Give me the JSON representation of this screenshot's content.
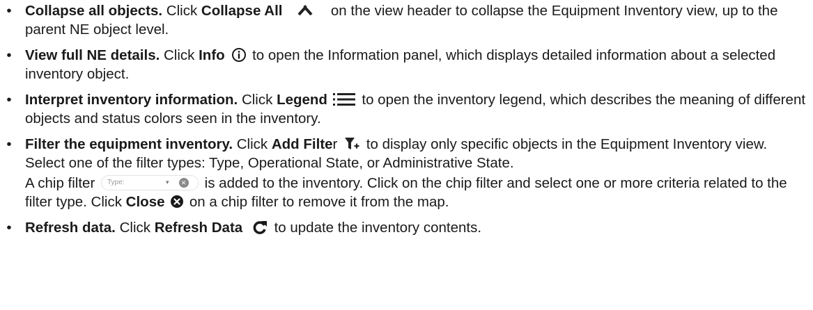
{
  "bullet_char": "•",
  "items": [
    {
      "title": "Collapse all objects.",
      "t1": " Click ",
      "label": "Collapse All",
      "t2": " on the view header to collapse the Equipment Inventory view, up to the parent NE object level.",
      "icon": "collapse-all-icon"
    },
    {
      "title": "View full NE details.",
      "t1": " Click ",
      "label": "Info",
      "t2": " to open the Information panel, which displays detailed information about a selected inventory object.",
      "icon": "info-icon"
    },
    {
      "title": "Interpret inventory information.",
      "t1": " Click ",
      "label": "Legend",
      "t2": " to open the inventory legend, which describes the meaning of different objects and status colors seen in the inventory.",
      "icon": "legend-list-icon"
    },
    {
      "title": "Filter the equipment inventory.",
      "t1": " Click ",
      "label": "Add Filte",
      "label_tail": "r",
      "t2": " to display only specific objects in the Equipment Inventory view. Select one of the filter types: Type, Operational State, or Administrative State.",
      "icon": "add-filter-icon",
      "para2": {
        "t1": "A chip filter ",
        "chip_label": "Type:",
        "t2": " is added to the inventory. Click on the chip filter and select one or more criteria related to the filter type. Click ",
        "close_label": "Close",
        "t3": " on a chip filter to remove it from the map.",
        "close_icon": "close-circle-icon"
      }
    },
    {
      "title": "Refresh data.",
      "t1": " Click ",
      "label": "Refresh Data",
      "t2": " to update the inventory contents.",
      "icon": "refresh-icon"
    }
  ]
}
